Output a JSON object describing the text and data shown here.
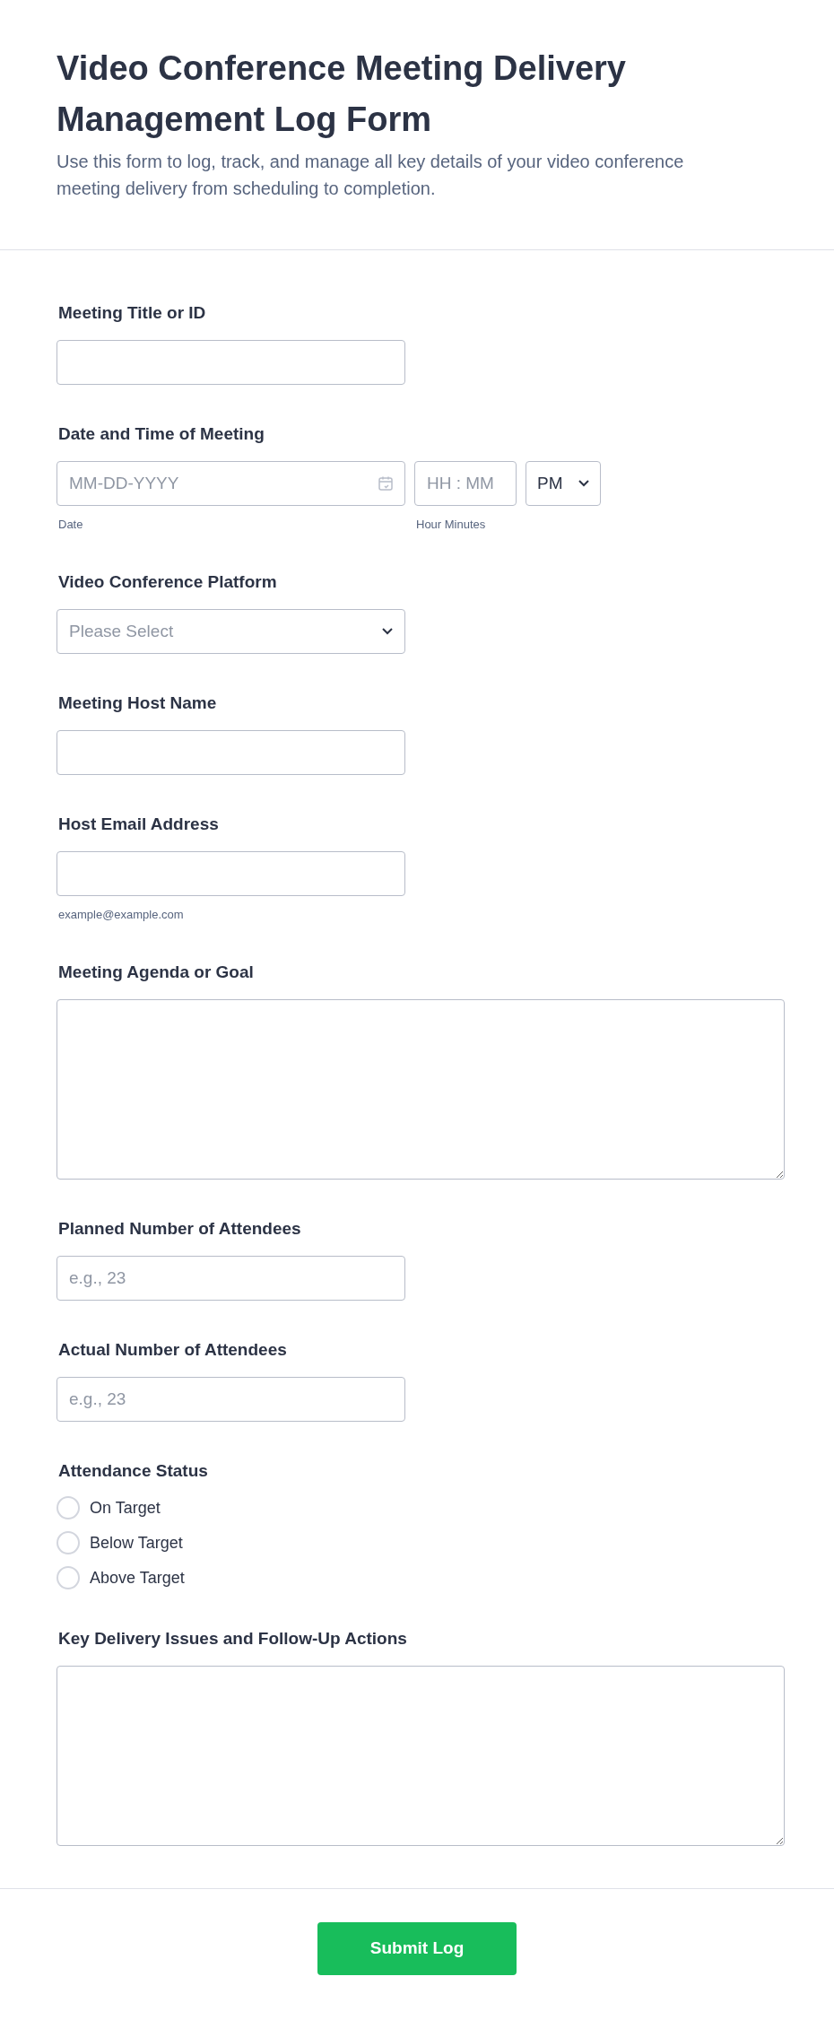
{
  "header": {
    "title": "Video Conference Meeting Delivery Management Log Form",
    "description": "Use this form to log, track, and manage all key details of your video conference meeting delivery from scheduling to completion."
  },
  "fields": [
    {
      "kind": "text",
      "label": "Meeting Title or ID"
    },
    {
      "kind": "datetime",
      "label": "Date and Time of Meeting",
      "date_placeholder": "MM-DD-YYYY",
      "date_sublabel": "Date",
      "time_placeholder": "HH : MM",
      "time_sublabel": "Hour Minutes",
      "ampm": "PM"
    },
    {
      "kind": "select",
      "label": "Video Conference Platform",
      "placeholder": "Please Select"
    },
    {
      "kind": "text",
      "label": "Meeting Host Name"
    },
    {
      "kind": "text",
      "label": "Host Email Address",
      "sublabel": "example@example.com"
    },
    {
      "kind": "textarea",
      "label": "Meeting Agenda or Goal"
    },
    {
      "kind": "text",
      "label": "Planned Number of Attendees",
      "placeholder": "e.g., 23"
    },
    {
      "kind": "text",
      "label": "Actual Number of Attendees",
      "placeholder": "e.g., 23"
    },
    {
      "kind": "radio",
      "label": "Attendance Status",
      "options": [
        {
          "label": "On Target",
          "selected": false
        },
        {
          "label": "Below Target",
          "selected": false
        },
        {
          "label": "Above Target",
          "selected": false
        }
      ]
    },
    {
      "kind": "textarea",
      "label": "Key Delivery Issues and Follow-Up Actions"
    }
  ],
  "submit": "Submit Log"
}
